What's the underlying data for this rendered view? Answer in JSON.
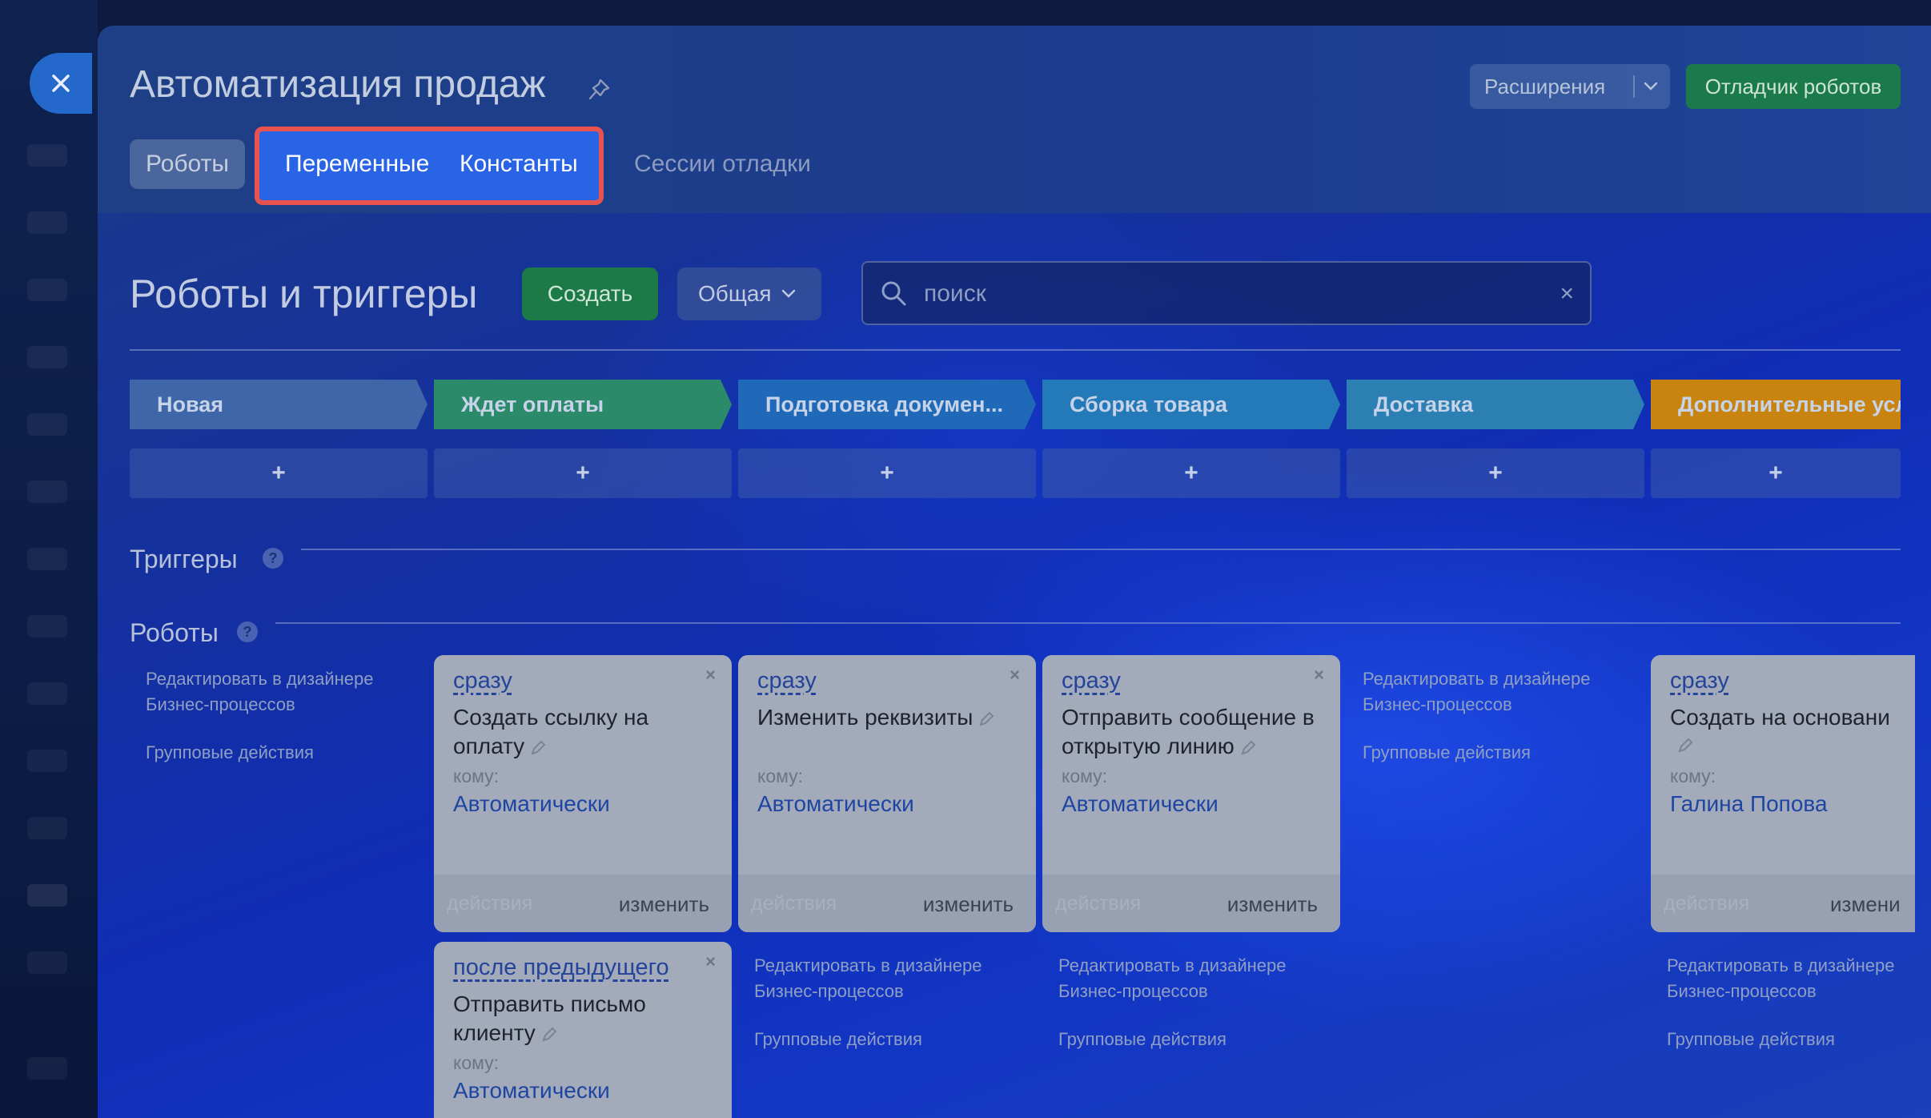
{
  "header": {
    "title": "Автоматизация продаж",
    "extensions_label": "Расширения",
    "debugger_label": "Отладчик роботов"
  },
  "tabs": [
    {
      "label": "Роботы"
    },
    {
      "label": "Переменные"
    },
    {
      "label": "Константы"
    },
    {
      "label": "Сессии отладки"
    }
  ],
  "toolbar": {
    "section_title": "Роботы и триггеры",
    "create_label": "Создать",
    "filter_label": "Общая",
    "search_placeholder": "поиск",
    "search_clear": "×"
  },
  "stages": [
    {
      "name": "Новая",
      "color": "#3e66a8"
    },
    {
      "name": "Ждет оплаты",
      "color": "#2a8a6a"
    },
    {
      "name": "Подготовка докумен...",
      "color": "#1f69b8"
    },
    {
      "name": "Сборка товара",
      "color": "#2479b8"
    },
    {
      "name": "Доставка",
      "color": "#2b7fb3"
    },
    {
      "name": "Дополнительные усл",
      "color": "#c9830f"
    }
  ],
  "add_symbol": "+",
  "sections": {
    "triggers": "Триггеры",
    "robots": "Роботы",
    "help": "?"
  },
  "links": {
    "edit_designer_line1": "Редактировать в дизайнере",
    "edit_designer_line2": "Бизнес-процессов",
    "group_actions": "Групповые действия"
  },
  "cards": [
    {
      "when": "сразу",
      "title": "Создать ссылку на оплату",
      "to_label": "кому:",
      "to_value": "Автоматически",
      "actions": "действия",
      "edit": "изменить",
      "close": "×"
    },
    {
      "when": "сразу",
      "title": "Изменить реквизиты",
      "to_label": "кому:",
      "to_value": "Автоматически",
      "actions": "действия",
      "edit": "изменить",
      "close": "×"
    },
    {
      "when": "сразу",
      "title": "Отправить сообщение в открытую линию",
      "to_label": "кому:",
      "to_value": "Автоматически",
      "actions": "действия",
      "edit": "изменить",
      "close": "×"
    },
    {
      "when": "сразу",
      "title": "Создать на основани",
      "to_label": "кому:",
      "to_value": "Галина Попова",
      "actions": "действия",
      "edit": "измени",
      "close": "×"
    },
    {
      "when": "после предыдущего",
      "title": "Отправить письмо клиенту",
      "to_label": "кому:",
      "to_value": "Автоматически",
      "close": "×"
    }
  ],
  "colors": {
    "highlight_border": "#e8524f",
    "highlight_fill": "#2a64e6",
    "create_green": "#1c7a46"
  }
}
